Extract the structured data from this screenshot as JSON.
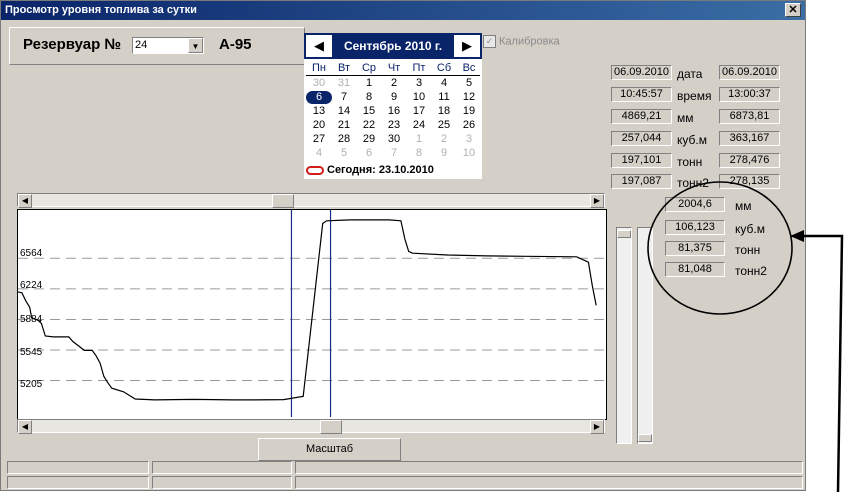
{
  "window": {
    "title": "Просмотр уровня топлива за сутки",
    "close_glyph": "✕"
  },
  "tank": {
    "label": "Резервуар №",
    "selected": "24",
    "fuel": "А-95"
  },
  "calendar": {
    "prev": "◀",
    "next": "▶",
    "month": "Сентябрь 2010 г.",
    "weekdays": [
      "Пн",
      "Вт",
      "Ср",
      "Чт",
      "Пт",
      "Сб",
      "Вс"
    ],
    "weeks": [
      [
        "30",
        "31",
        "1",
        "2",
        "3",
        "4",
        "5"
      ],
      [
        "6",
        "7",
        "8",
        "9",
        "10",
        "11",
        "12"
      ],
      [
        "13",
        "14",
        "15",
        "16",
        "17",
        "18",
        "19"
      ],
      [
        "20",
        "21",
        "22",
        "23",
        "24",
        "25",
        "26"
      ],
      [
        "27",
        "28",
        "29",
        "30",
        "1",
        "2",
        "3"
      ],
      [
        "4",
        "5",
        "6",
        "7",
        "8",
        "9",
        "10"
      ]
    ],
    "selected_day": "6",
    "today_text": "Сегодня: 23.10.2010"
  },
  "calibration": {
    "label": "Калибровка",
    "checked": true
  },
  "readings": [
    {
      "left": "06.09.2010",
      "label": "дата",
      "right": "06.09.2010"
    },
    {
      "left": "10:45:57",
      "label": "время",
      "right": "13:00:37"
    },
    {
      "left": "4869,21",
      "label": "мм",
      "right": "6873,81"
    },
    {
      "left": "257,044",
      "label": "куб.м",
      "right": "363,167"
    },
    {
      "left": "197,101",
      "label": "тонн",
      "right": "278,476"
    },
    {
      "left": "197,087",
      "label": "тонн2",
      "right": "278,135"
    }
  ],
  "diff": [
    {
      "value": "2004,6",
      "label": "мм"
    },
    {
      "value": "106,123",
      "label": "куб.м"
    },
    {
      "value": "81,375",
      "label": "тонн"
    },
    {
      "value": "81,048",
      "label": "тонн2"
    }
  ],
  "chart": {
    "y_ticks": [
      "6564",
      "6224",
      "5884",
      "5545",
      "5205"
    ]
  },
  "scale_button": "Масштаб",
  "chart_data": {
    "type": "line",
    "ylim": [
      4800,
      7100
    ],
    "grid": true,
    "y_ticks": [
      6564,
      6224,
      5884,
      5545,
      5205
    ],
    "series": [
      {
        "points": [
          [
            0,
            6190
          ],
          [
            1,
            6180
          ],
          [
            2,
            6090
          ],
          [
            3,
            6020
          ],
          [
            3.5,
            5900
          ],
          [
            5,
            5880
          ],
          [
            6,
            5840
          ],
          [
            7,
            5700
          ],
          [
            9,
            5690
          ],
          [
            13,
            5690
          ],
          [
            14,
            5640
          ],
          [
            17,
            5540
          ],
          [
            19,
            5540
          ],
          [
            20,
            5480
          ],
          [
            21,
            5400
          ],
          [
            22,
            5250
          ],
          [
            23,
            5180
          ],
          [
            24,
            5120
          ],
          [
            27,
            5080
          ],
          [
            30,
            5000
          ],
          [
            35,
            4990
          ],
          [
            45,
            4995
          ],
          [
            55,
            4990
          ],
          [
            60,
            4990
          ],
          [
            68,
            4993
          ],
          [
            73,
            5030
          ],
          [
            78,
            6950
          ],
          [
            79,
            6980
          ],
          [
            85,
            6990
          ],
          [
            95,
            6990
          ],
          [
            98,
            6980
          ],
          [
            99,
            6780
          ],
          [
            100,
            6640
          ],
          [
            101,
            6620
          ],
          [
            110,
            6600
          ],
          [
            120,
            6590
          ],
          [
            130,
            6585
          ],
          [
            143,
            6580
          ],
          [
            146,
            6520
          ],
          [
            147,
            6260
          ],
          [
            148,
            6040
          ]
        ]
      }
    ],
    "cursors": [
      70,
      80
    ]
  }
}
